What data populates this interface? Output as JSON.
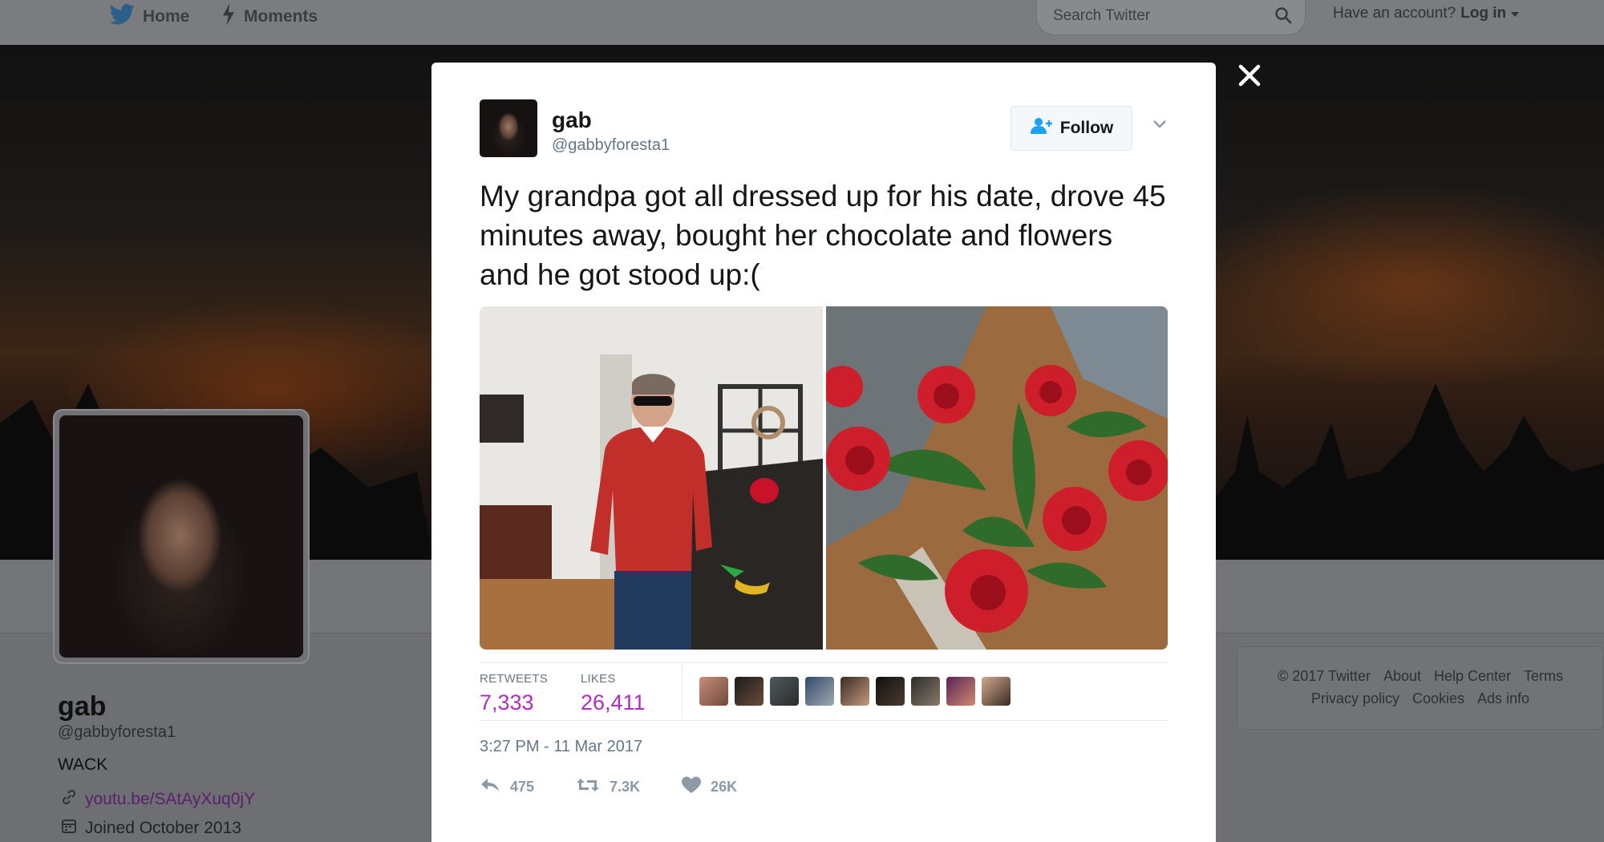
{
  "topbar": {
    "home_label": "Home",
    "moments_label": "Moments",
    "search_placeholder": "Search Twitter",
    "login_prompt": "Have an account?",
    "login_label": "Log in"
  },
  "profile": {
    "name": "gab",
    "handle": "@gabbyforesta1",
    "bio": "WACK",
    "link": "youtu.be/SAtAyXuq0jY",
    "joined": "Joined October 2013"
  },
  "footer": {
    "row1": [
      "© 2017 Twitter",
      "About",
      "Help Center",
      "Terms"
    ],
    "row2": [
      "Privacy policy",
      "Cookies",
      "Ads info"
    ]
  },
  "tweet": {
    "author_name": "gab",
    "author_handle": "@gabbyforesta1",
    "follow_label": "Follow",
    "text": "My grandpa got all dressed up for his date, drove 45 minutes away, bought her chocolate and flowers and he got stood up:(",
    "retweets_label": "RETWEETS",
    "retweets_count": "7,333",
    "likes_label": "LIKES",
    "likes_count": "26,411",
    "timestamp": "3:27 PM - 11 Mar 2017",
    "reply_count": "475",
    "retweet_count_short": "7.3K",
    "like_count_short": "26K"
  },
  "colors": {
    "accent_twitter": "#1da1f2",
    "stat_value": "#b12cc0",
    "link": "#5b1f6e"
  },
  "icons": [
    "twitter-bird-icon",
    "lightning-icon",
    "search-icon",
    "close-icon",
    "add-user-icon",
    "chevron-down-icon",
    "link-icon",
    "calendar-icon",
    "reply-icon",
    "retweet-icon",
    "heart-icon"
  ]
}
